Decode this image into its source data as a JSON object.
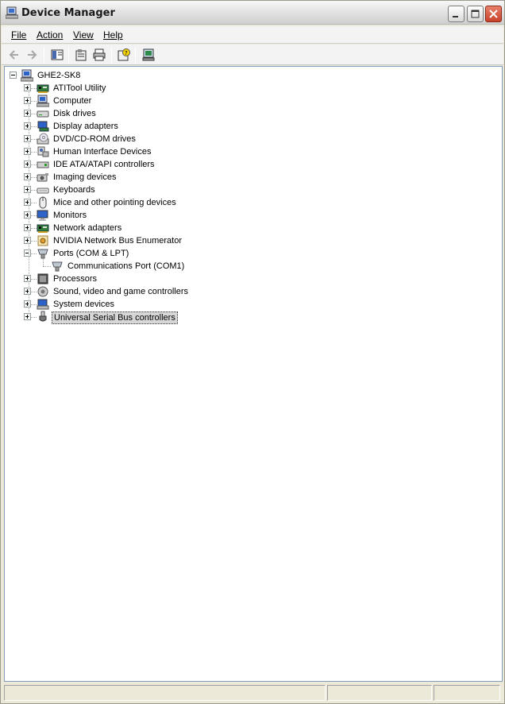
{
  "window": {
    "title": "Device Manager",
    "controls": {
      "minimize": "minimize",
      "maximize": "maximize",
      "close": "close"
    }
  },
  "menubar": {
    "items": [
      {
        "label": "File",
        "mnemonic": "F"
      },
      {
        "label": "Action",
        "mnemonic": "A"
      },
      {
        "label": "View",
        "mnemonic": "V"
      },
      {
        "label": "Help",
        "mnemonic": "H"
      }
    ]
  },
  "toolbar": {
    "buttons": [
      {
        "name": "back",
        "icon": "arrow-left-icon",
        "enabled": false
      },
      {
        "name": "forward",
        "icon": "arrow-right-icon",
        "enabled": false
      },
      {
        "name": "show-hide-console-tree",
        "icon": "console-tree-icon",
        "enabled": true
      },
      {
        "name": "properties",
        "icon": "properties-icon",
        "enabled": true
      },
      {
        "name": "print",
        "icon": "printer-icon",
        "enabled": true
      },
      {
        "name": "help",
        "icon": "help-icon",
        "enabled": true
      },
      {
        "name": "scan-hardware",
        "icon": "scan-hardware-icon",
        "enabled": true
      }
    ]
  },
  "tree": {
    "root": {
      "label": "GHE2-SK8",
      "icon": "computer-icon",
      "expanded": true
    },
    "items": [
      {
        "label": "ATITool Utility",
        "icon": "network-card-icon",
        "expanded": false
      },
      {
        "label": "Computer",
        "icon": "computer-icon",
        "expanded": false
      },
      {
        "label": "Disk drives",
        "icon": "disk-drive-icon",
        "expanded": false
      },
      {
        "label": "Display adapters",
        "icon": "display-adapter-icon",
        "expanded": false
      },
      {
        "label": "DVD/CD-ROM drives",
        "icon": "cdrom-icon",
        "expanded": false
      },
      {
        "label": "Human Interface Devices",
        "icon": "hid-icon",
        "expanded": false
      },
      {
        "label": "IDE ATA/ATAPI controllers",
        "icon": "ide-controller-icon",
        "expanded": false
      },
      {
        "label": "Imaging devices",
        "icon": "camera-icon",
        "expanded": false
      },
      {
        "label": "Keyboards",
        "icon": "keyboard-icon",
        "expanded": false
      },
      {
        "label": "Mice and other pointing devices",
        "icon": "mouse-icon",
        "expanded": false
      },
      {
        "label": "Monitors",
        "icon": "monitor-icon",
        "expanded": false
      },
      {
        "label": "Network adapters",
        "icon": "network-card-icon",
        "expanded": false
      },
      {
        "label": "NVIDIA Network Bus Enumerator",
        "icon": "bus-enumerator-icon",
        "expanded": false
      },
      {
        "label": "Ports (COM & LPT)",
        "icon": "port-icon",
        "expanded": true,
        "children": [
          {
            "label": "Communications Port (COM1)",
            "icon": "port-icon"
          }
        ]
      },
      {
        "label": "Processors",
        "icon": "processor-icon",
        "expanded": false
      },
      {
        "label": "Sound, video and game controllers",
        "icon": "sound-icon",
        "expanded": false
      },
      {
        "label": "System devices",
        "icon": "system-device-icon",
        "expanded": false
      },
      {
        "label": "Universal Serial Bus controllers",
        "icon": "usb-icon",
        "expanded": false,
        "selected": true
      }
    ]
  },
  "colors": {
    "tree_line": "#a0a0a0",
    "selection_bg": "#d7d7d7",
    "window_frame": "#ece9d8"
  }
}
